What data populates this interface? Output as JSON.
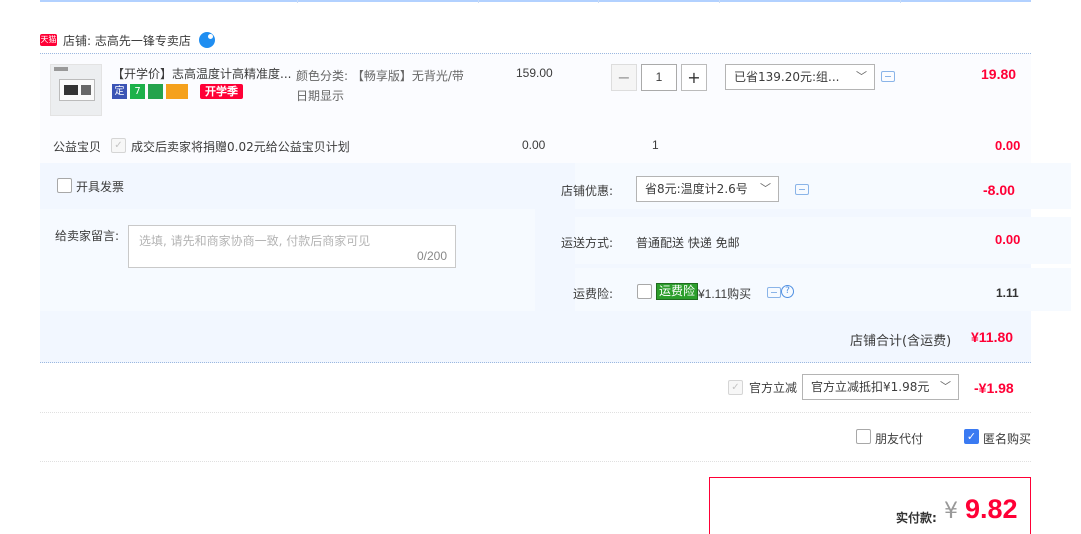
{
  "shop": {
    "platform_badge": "天猫",
    "name": "店铺: 志高先一锋专卖店"
  },
  "item": {
    "title": "【开学价】志高温度计高精准度...",
    "badges": [
      "定",
      "7",
      "",
      "",
      "开学季"
    ],
    "sku_line1": "颜色分类: 【畅享版】无背光/带",
    "sku_line2": "日期显示",
    "price": "159.00",
    "quantity": "1",
    "discount_select": "已省139.20元:组...",
    "subtotal": "19.80"
  },
  "charity": {
    "label": "公益宝贝",
    "text": "成交后卖家将捐赠0.02元给公益宝贝计划",
    "price": "0.00",
    "quantity": "1",
    "subtotal": "0.00"
  },
  "invoice": {
    "label": "开具发票"
  },
  "message": {
    "label": "给卖家留言:",
    "placeholder": "选填, 请先和商家协商一致, 付款后商家可见",
    "counter": "0/200"
  },
  "shop_coupon": {
    "label": "店铺优惠:",
    "selected": "省8元:温度计2.6号",
    "amount": "-8.00"
  },
  "shipping": {
    "label": "运送方式:",
    "value": "普通配送 快递 免邮",
    "amount": "0.00"
  },
  "freight_insurance": {
    "label": "运费险:",
    "tag": "运费险",
    "price_text": "¥1.11购买",
    "amount": "1.11"
  },
  "shop_total": {
    "label": "店铺合计(含运费)",
    "amount": "¥11.80"
  },
  "official_discount": {
    "label": "官方立减",
    "selected": "官方立减抵扣¥1.98元",
    "amount": "-¥1.98"
  },
  "options": {
    "friend_pay": "朋友代付",
    "anonymous": "匿名购买"
  },
  "payment": {
    "label": "实付款:",
    "currency": "¥",
    "amount": "9.82"
  },
  "colors": {
    "accent_red": "#ff0036",
    "light_blue_bg": "#f2f7ff",
    "border_blue": "#b2d1ff"
  }
}
